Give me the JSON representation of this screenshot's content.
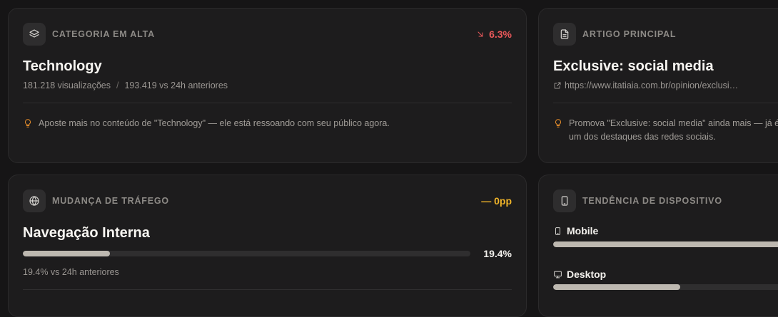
{
  "category": {
    "header": "CATEGORIA EM ALTA",
    "delta": "6.3%",
    "delta_direction": "down",
    "title": "Technology",
    "views": "181.218 visualizações",
    "separator": "/",
    "comparison": "193.419 vs 24h anteriores",
    "tip": "Aposte mais no conteúdo de \"Technology\" — ele está ressoando com seu público agora.",
    "icon": "layers-icon"
  },
  "article": {
    "header": "ARTIGO PRINCIPAL",
    "title": "Exclusive: social media",
    "url": "https://www.itatiaia.com.br/opinion/exclusi…",
    "tip": "Promova \"Exclusive: social media\" ainda mais — já é um dos destaques das redes sociais.",
    "icon": "document-icon"
  },
  "traffic": {
    "header": "MUDANÇA DE TRÁFEGO",
    "delta": "— 0pp",
    "title": "Navegação Interna",
    "percent_label": "19.4%",
    "percent_value": 19.4,
    "comparison": "19.4% vs 24h anteriores",
    "icon": "globe-icon"
  },
  "device": {
    "header": "TENDÊNCIA DE DISPOSITIVO",
    "icon": "phone-icon",
    "items": [
      {
        "label": "Mobile",
        "share": 100,
        "icon": "phone-icon"
      },
      {
        "label": "Desktop",
        "share": 54,
        "icon": "monitor-icon"
      }
    ]
  },
  "colors": {
    "down": "#e9585a",
    "flat": "#f0b429",
    "tip_icon": "#e08a2a",
    "bar_fill": "#bdb8b0"
  }
}
